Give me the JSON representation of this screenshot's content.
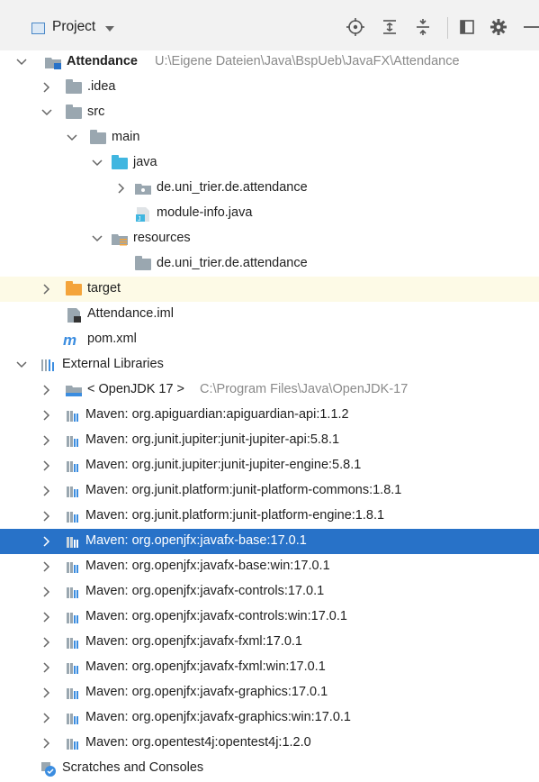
{
  "header": {
    "title": "Project"
  },
  "tree": {
    "root": {
      "label": "Attendance",
      "path": "U:\\Eigene Dateien\\Java\\BspUeb\\JavaFX\\Attendance"
    },
    "idea": ".idea",
    "src": "src",
    "main": "main",
    "java": "java",
    "pkg": "de.uni_trier.de.attendance",
    "module_info": "module-info.java",
    "resources": "resources",
    "res_pkg": "de.uni_trier.de.attendance",
    "target": "target",
    "iml": "Attendance.iml",
    "pom": "pom.xml",
    "ext_libs": "External Libraries",
    "jdk": {
      "label": "< OpenJDK 17 >",
      "path": "C:\\Program Files\\Java\\OpenJDK-17"
    },
    "libs": [
      "Maven: org.apiguardian:apiguardian-api:1.1.2",
      "Maven: org.junit.jupiter:junit-jupiter-api:5.8.1",
      "Maven: org.junit.jupiter:junit-jupiter-engine:5.8.1",
      "Maven: org.junit.platform:junit-platform-commons:1.8.1",
      "Maven: org.junit.platform:junit-platform-engine:1.8.1",
      "Maven: org.openjfx:javafx-base:17.0.1",
      "Maven: org.openjfx:javafx-base:win:17.0.1",
      "Maven: org.openjfx:javafx-controls:17.0.1",
      "Maven: org.openjfx:javafx-controls:win:17.0.1",
      "Maven: org.openjfx:javafx-fxml:17.0.1",
      "Maven: org.openjfx:javafx-fxml:win:17.0.1",
      "Maven: org.openjfx:javafx-graphics:17.0.1",
      "Maven: org.openjfx:javafx-graphics:win:17.0.1",
      "Maven: org.opentest4j:opentest4j:1.2.0"
    ],
    "scratches": "Scratches and Consoles"
  },
  "colors": {
    "selection": "#2872c8",
    "highlight": "#fdfae6",
    "folder_gray": "#9aa7b0",
    "folder_blue": "#40b6e0",
    "folder_orange": "#f4a43b"
  },
  "icons": {
    "toolbar": [
      "locate-icon",
      "expand-all-icon",
      "collapse-all-icon",
      "layout-icon",
      "gear-icon",
      "minimize-icon"
    ]
  }
}
